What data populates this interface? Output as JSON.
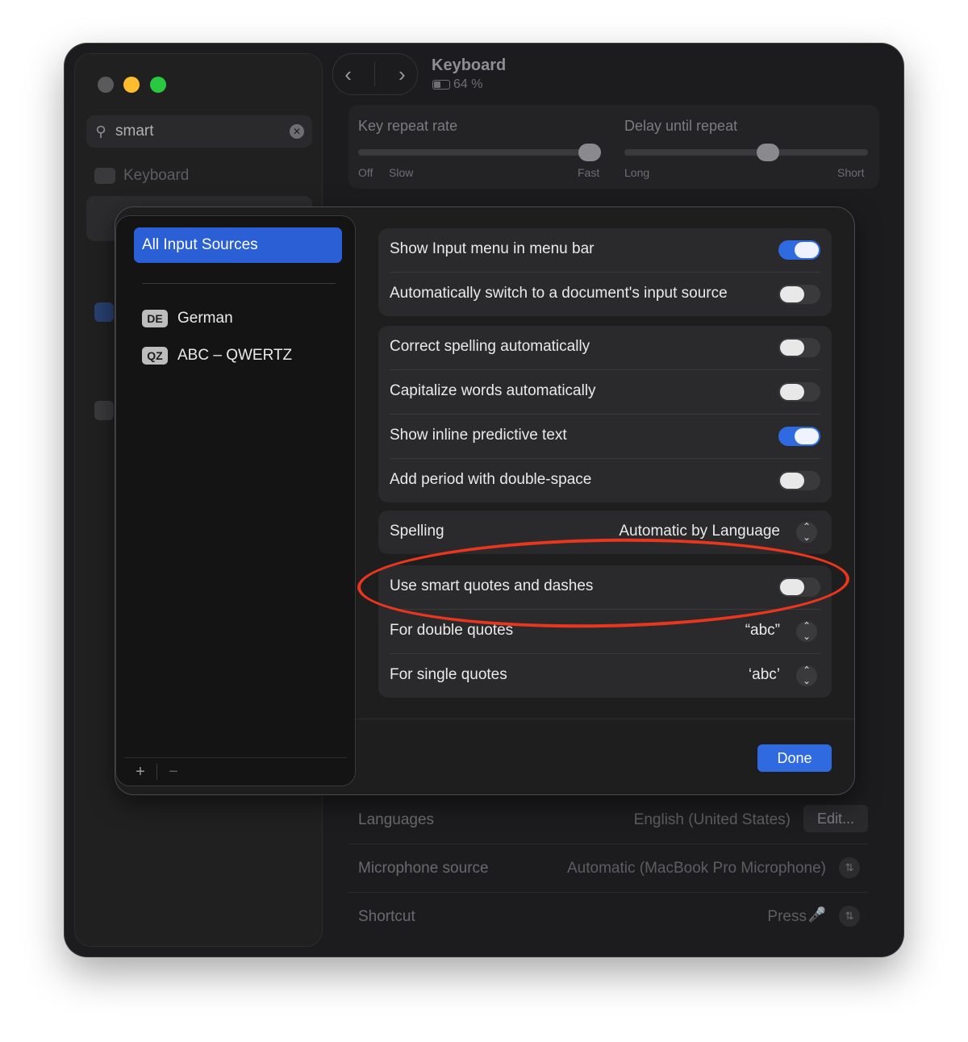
{
  "window": {
    "title": "Keyboard",
    "battery": "64 %"
  },
  "sidebar": {
    "search_value": "smart",
    "items": [
      {
        "label": "Keyboard"
      }
    ]
  },
  "background": {
    "key_repeat": {
      "label": "Key repeat rate",
      "min": "Off",
      "slow": "Slow",
      "max": "Fast",
      "level": 0.95
    },
    "delay": {
      "label": "Delay until repeat",
      "min": "Long",
      "max": "Short",
      "level": 0.55
    },
    "rows": [
      {
        "label": "Languages",
        "value": "English (United States)",
        "button": "Edit..."
      },
      {
        "label": "Microphone source",
        "value": "Automatic (MacBook Pro Microphone)"
      },
      {
        "label": "Shortcut",
        "value": "Press"
      }
    ]
  },
  "sheet": {
    "sources": {
      "all_label": "All Input Sources",
      "items": [
        {
          "badge": "DE",
          "name": "German"
        },
        {
          "badge": "QZ",
          "name": "ABC – QWERTZ"
        }
      ],
      "add": "+",
      "remove": "−"
    },
    "group1": [
      {
        "label": "Show Input menu in menu bar",
        "on": true
      },
      {
        "label": "Automatically switch to a document's input source",
        "on": false
      }
    ],
    "group2": [
      {
        "label": "Correct spelling automatically",
        "on": false
      },
      {
        "label": "Capitalize words automatically",
        "on": false
      },
      {
        "label": "Show inline predictive text",
        "on": true
      },
      {
        "label": "Add period with double-space",
        "on": false
      }
    ],
    "spelling": {
      "label": "Spelling",
      "value": "Automatic by Language"
    },
    "group4": {
      "smart_quotes": {
        "label": "Use smart quotes and dashes",
        "on": false
      },
      "double_quotes": {
        "label": "For double quotes",
        "value": "“abc”"
      },
      "single_quotes": {
        "label": "For single quotes",
        "value": "‘abc’"
      }
    },
    "done_label": "Done"
  },
  "colors": {
    "accent": "#2f6ae0",
    "highlight": "#e8361f"
  }
}
